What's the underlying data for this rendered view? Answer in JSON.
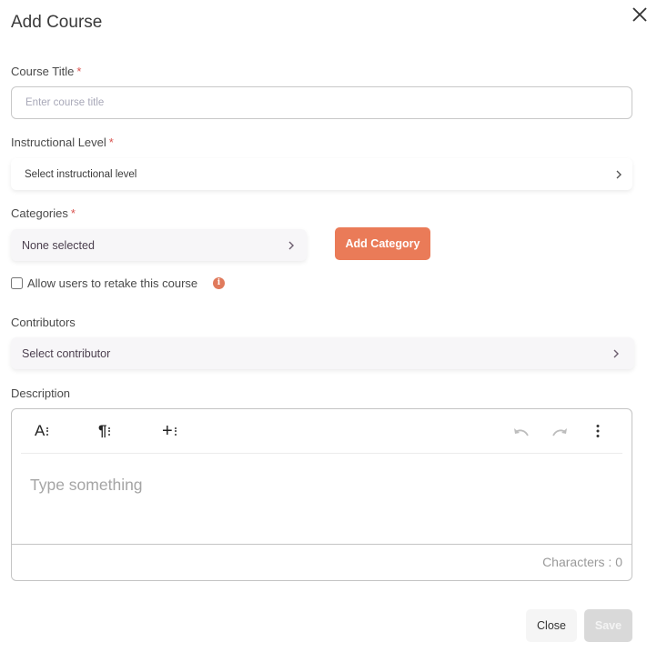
{
  "dialog": {
    "title": "Add Course",
    "close_icon": "close-icon"
  },
  "fields": {
    "course_title": {
      "label": "Course Title",
      "required_mark": "*",
      "value": "",
      "placeholder": "Enter course title"
    },
    "instructional_level": {
      "label": "Instructional Level",
      "required_mark": "*",
      "value": "Select instructional level"
    },
    "categories": {
      "label": "Categories",
      "required_mark": "*",
      "value": "None selected",
      "add_button_label": "Add Category"
    },
    "retake": {
      "label": "Allow users to retake this course",
      "checked": false,
      "info_icon": "info-icon"
    },
    "contributors": {
      "label": "Contributors",
      "value": "Select contributor"
    },
    "description": {
      "label": "Description",
      "placeholder": "Type something",
      "toolbar": {
        "font_style": "A",
        "paragraph_style": "¶",
        "insert": "+",
        "undo_icon": "undo-icon",
        "redo_icon": "redo-icon",
        "more_icon": "more-vertical-icon"
      },
      "character_count_label": "Characters : 0"
    }
  },
  "footer": {
    "close_label": "Close",
    "save_label": "Save"
  },
  "colors": {
    "accent": "#ea7b58",
    "required": "#d9534f",
    "disabled": "#d9d9d9"
  }
}
